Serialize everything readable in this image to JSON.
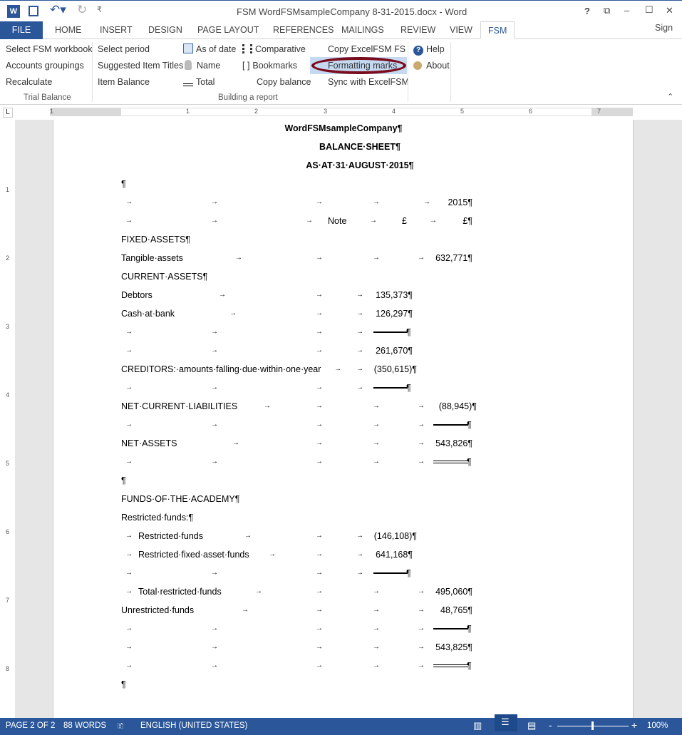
{
  "window": {
    "title": "FSM WordFSMsampleCompany 8-31-2015.docx - Word",
    "help": "?",
    "minimize": "‒",
    "maximize": "☐",
    "close": "✕",
    "restore_ribbon": "⧉",
    "sign_in": "Sign in"
  },
  "tabs": [
    "FILE",
    "HOME",
    "INSERT",
    "DESIGN",
    "PAGE LAYOUT",
    "REFERENCES",
    "MAILINGS",
    "REVIEW",
    "VIEW",
    "FSM"
  ],
  "ribbon": {
    "trial_balance": {
      "label": "Trial Balance",
      "items": [
        "Select FSM workbook",
        "Accounts groupings",
        "Recalculate"
      ]
    },
    "building": {
      "label": "Building a report",
      "col1": [
        "Select period",
        "Suggested Item Titles",
        "Item Balance"
      ],
      "col2": [
        "As of date",
        "Name",
        "Total"
      ],
      "col3": [
        "Comparative",
        "Bookmarks",
        "Copy balance"
      ],
      "col4": [
        "Copy ExcelFSM FS",
        "Formatting marks",
        "Sync with ExcelFSM"
      ]
    },
    "help": [
      "Help",
      "About"
    ],
    "highlighted": "Formatting marks",
    "highlight_color": "#c5d9f1",
    "ellipse_color": "#7b0c1c"
  },
  "ruler": {
    "numbers": [
      "1",
      "1",
      "2",
      "3",
      "4",
      "5",
      "6",
      "7"
    ]
  },
  "vruler": {
    "numbers": [
      "1",
      "2",
      "3",
      "4",
      "5",
      "6",
      "7",
      "8"
    ]
  },
  "doc": {
    "rows": [
      [
        "WordFSMsampleCompany¶"
      ],
      [
        "BALANCE·SHEET¶"
      ],
      [
        "AS·AT·31·AUGUST·2015¶"
      ],
      [
        "¶"
      ],
      [
        "→",
        "→",
        "→",
        "→",
        "→",
        "2015¶"
      ],
      [
        "→",
        "→",
        "→",
        "Note",
        "→",
        "£",
        "→",
        "£¶"
      ],
      [
        "FIXED·ASSETS¶"
      ],
      [
        "Tangible·assets",
        "→",
        "→",
        "→",
        "→",
        "632,771¶"
      ],
      [
        "CURRENT·ASSETS¶"
      ],
      [
        "Debtors",
        "→",
        "→",
        "→",
        "135,373¶"
      ],
      [
        "Cash·at·bank",
        "→",
        "→",
        "→",
        "126,297¶"
      ],
      [
        "→",
        "→",
        "→",
        "→",
        "¶"
      ],
      [
        "→",
        "→",
        "→",
        "→",
        "261,670¶"
      ],
      [
        "CREDITORS:·amounts·falling·due·within·one·year",
        "→",
        "→",
        "(350,615)¶"
      ],
      [
        "→",
        "→",
        "→",
        "→",
        "¶"
      ],
      [
        "NET·CURRENT·LIABILITIES",
        "→",
        "→",
        "→",
        "→",
        "(88,945)¶"
      ],
      [
        "→",
        "→",
        "→",
        "→",
        "→",
        "¶"
      ],
      [
        "NET·ASSETS",
        "→",
        "→",
        "→",
        "→",
        "543,826¶"
      ],
      [
        "→",
        "→",
        "→",
        "→",
        "→",
        "¶"
      ],
      [
        "¶"
      ],
      [
        "FUNDS·OF·THE·ACADEMY¶"
      ],
      [
        "Restricted·funds:¶"
      ],
      [
        "→",
        "Restricted·funds",
        "→",
        "→",
        "→",
        "(146,108)¶"
      ],
      [
        "→",
        "Restricted·fixed·asset·funds",
        "→",
        "→",
        "→",
        "641,168¶"
      ],
      [
        "→",
        "→",
        "→",
        "→",
        "¶"
      ],
      [
        "→",
        "Total·restricted·funds",
        "→",
        "→",
        "→",
        "→",
        "495,060¶"
      ],
      [
        "Unrestricted·funds",
        "→",
        "→",
        "→",
        "→",
        "48,765¶"
      ],
      [
        "→",
        "→",
        "→",
        "→",
        "→",
        "¶"
      ],
      [
        "→",
        "→",
        "→",
        "→",
        "→",
        "543,825¶"
      ],
      [
        "→",
        "→",
        "→",
        "→",
        "→",
        "¶"
      ],
      [
        "¶"
      ]
    ]
  },
  "status": {
    "page": "PAGE 2 OF 2",
    "words": "88 WORDS",
    "language": "ENGLISH (UNITED STATES)",
    "zoom": "100%",
    "zoom_minus": "-",
    "zoom_plus": "+"
  }
}
